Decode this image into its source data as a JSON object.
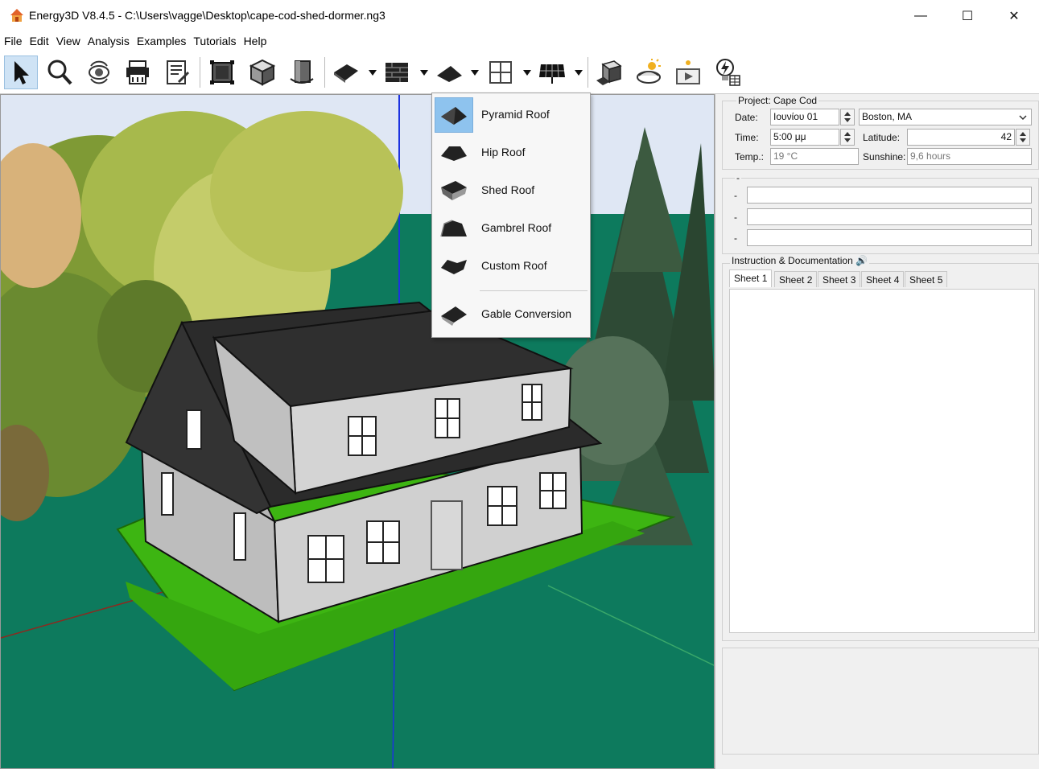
{
  "window": {
    "title": "Energy3D V8.4.5 - C:\\Users\\vagge\\Desktop\\cape-cod-shed-dormer.ng3",
    "minimize_glyph": "—",
    "maximize_glyph": "☐",
    "close_glyph": "✕"
  },
  "menubar": [
    "File",
    "Edit",
    "View",
    "Analysis",
    "Examples",
    "Tutorials",
    "Help"
  ],
  "toolbar": {
    "tools": [
      "select-icon",
      "zoom-icon",
      "rotate-view-icon",
      "print-icon",
      "notes-icon",
      "resize-icon",
      "box-icon",
      "spin-icon",
      "foundation-icon",
      "wall-icon",
      "roof-icon",
      "window-icon",
      "solar-panel-icon",
      "shadow-icon",
      "sun-icon",
      "animation-icon",
      "energy-analysis-icon"
    ]
  },
  "roof_menu": {
    "items": [
      {
        "label": "Pyramid Roof",
        "icon": "pyramid-roof-icon",
        "selected": true
      },
      {
        "label": "Hip Roof",
        "icon": "hip-roof-icon"
      },
      {
        "label": "Shed Roof",
        "icon": "shed-roof-icon"
      },
      {
        "label": "Gambrel Roof",
        "icon": "gambrel-roof-icon"
      },
      {
        "label": "Custom Roof",
        "icon": "custom-roof-icon"
      },
      {
        "label": "Gable Conversion",
        "icon": "gable-conversion-icon"
      }
    ]
  },
  "panel": {
    "project_label": "Project: Cape Cod",
    "date_label": "Date:",
    "date_value": "Ιουνίου 01",
    "location_value": "Boston, MA",
    "time_label": "Time:",
    "time_value": "5:00 μμ",
    "latitude_label": "Latitude:",
    "latitude_value": "42",
    "temp_label": "Temp.:",
    "temp_value": "19 °C",
    "sunshine_label": "Sunshine:",
    "sunshine_value": "9,6 hours",
    "section2_label": "-",
    "row_dashes": [
      "-",
      "-",
      "-"
    ],
    "doc_label": "Instruction & Documentation 🔊",
    "tabs": [
      "Sheet 1",
      "Sheet 2",
      "Sheet 3",
      "Sheet 4",
      "Sheet 5"
    ]
  },
  "colors": {
    "ground": "#0d7a5d",
    "lawn": "#3db512",
    "roof": "#2b2b2b",
    "wall": "#c9c9c9",
    "sky": "#dfe7f4"
  }
}
